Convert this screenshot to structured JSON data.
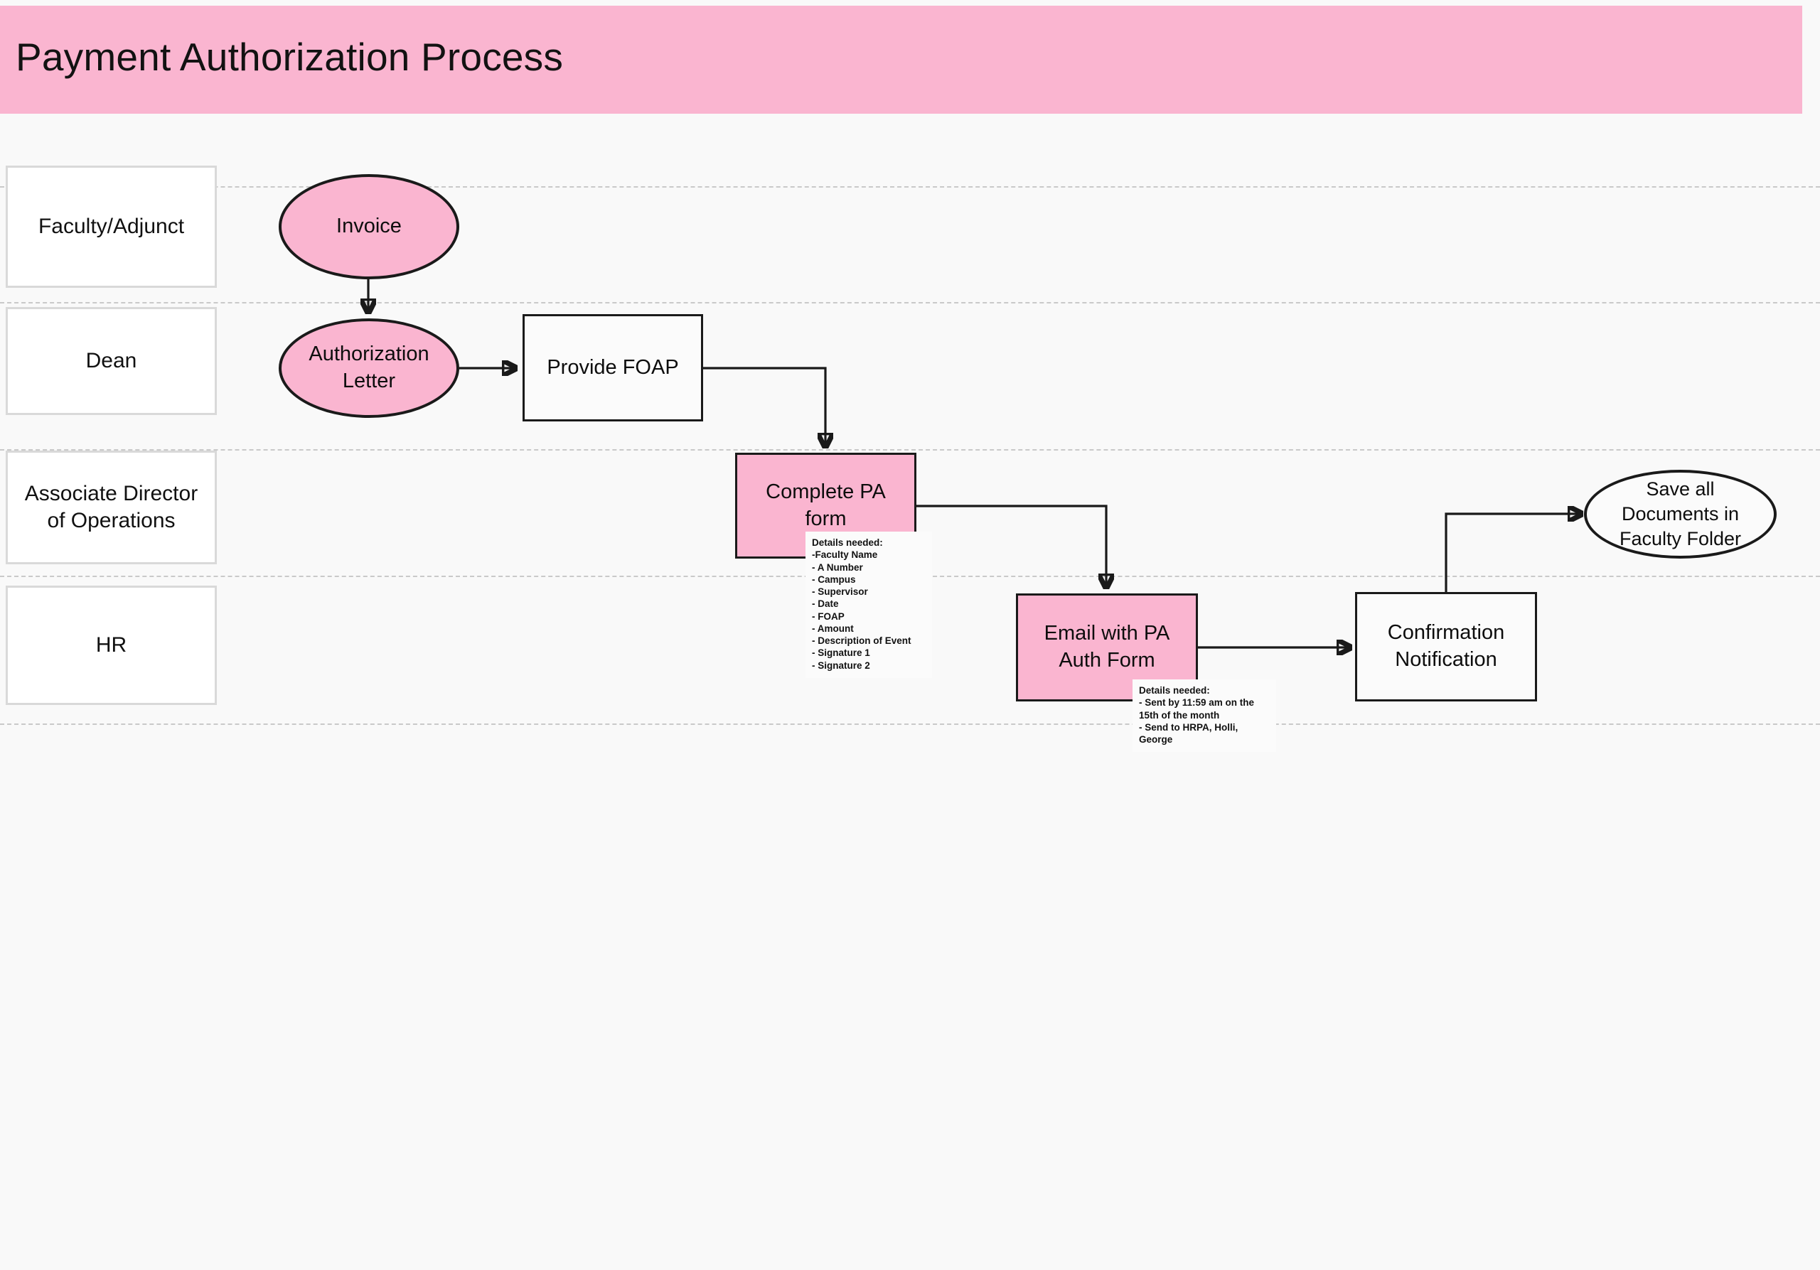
{
  "page": {
    "title": "Payment Authorization Process",
    "background_color": "#f9f9f9",
    "accent_color": "#fab5d0",
    "outline_color": "#1a1a1a",
    "lane_divider_color": "#c9c9c9"
  },
  "lanes": [
    {
      "id": "faculty",
      "label": "Faculty/Adjunct"
    },
    {
      "id": "dean",
      "label": "Dean"
    },
    {
      "id": "assoc-dir",
      "label": "Associate Director of Operations"
    },
    {
      "id": "hr",
      "label": "HR"
    }
  ],
  "nodes": [
    {
      "id": "invoice",
      "label": "Invoice",
      "shape": "ellipse",
      "fill": "#fab5d0",
      "lane": "faculty"
    },
    {
      "id": "authorization-letter",
      "label": "Authorization Letter",
      "shape": "ellipse",
      "fill": "#fab5d0",
      "lane": "dean"
    },
    {
      "id": "provide-foap",
      "label": "Provide FOAP",
      "shape": "rect",
      "fill": "#ffffff",
      "lane": "dean"
    },
    {
      "id": "complete-pa-form",
      "label": "Complete PA form",
      "shape": "rect",
      "fill": "#fab5d0",
      "lane": "assoc-dir"
    },
    {
      "id": "email-pa-auth-form",
      "label": "Email with PA Auth Form",
      "shape": "rect",
      "fill": "#fab5d0",
      "lane": "hr"
    },
    {
      "id": "confirmation-notification",
      "label": "Confirmation Notification",
      "shape": "rect",
      "fill": "#ffffff",
      "lane": "hr"
    },
    {
      "id": "save-all-documents",
      "label": "Save all Documents in Faculty Folder",
      "shape": "ellipse",
      "fill": "#ffffff",
      "lane": "assoc-dir"
    }
  ],
  "notes": [
    {
      "id": "pa-form-details",
      "attached_to": "complete-pa-form",
      "text": "Details needed:\n-Faculty Name\n- A Number\n- Campus\n- Supervisor\n- Date\n- FOAP\n- Amount\n- Description of Event\n- Signature 1\n- Signature 2"
    },
    {
      "id": "email-details",
      "attached_to": "email-pa-auth-form",
      "text": "Details needed:\n- Sent by 11:59 am on the 15th of the month\n- Send to HRPA, Holli, George"
    }
  ],
  "connectors": [
    {
      "from": "invoice",
      "to": "authorization-letter"
    },
    {
      "from": "authorization-letter",
      "to": "provide-foap"
    },
    {
      "from": "provide-foap",
      "to": "complete-pa-form"
    },
    {
      "from": "complete-pa-form",
      "to": "email-pa-auth-form"
    },
    {
      "from": "email-pa-auth-form",
      "to": "confirmation-notification"
    },
    {
      "from": "confirmation-notification",
      "to": "save-all-documents"
    }
  ]
}
